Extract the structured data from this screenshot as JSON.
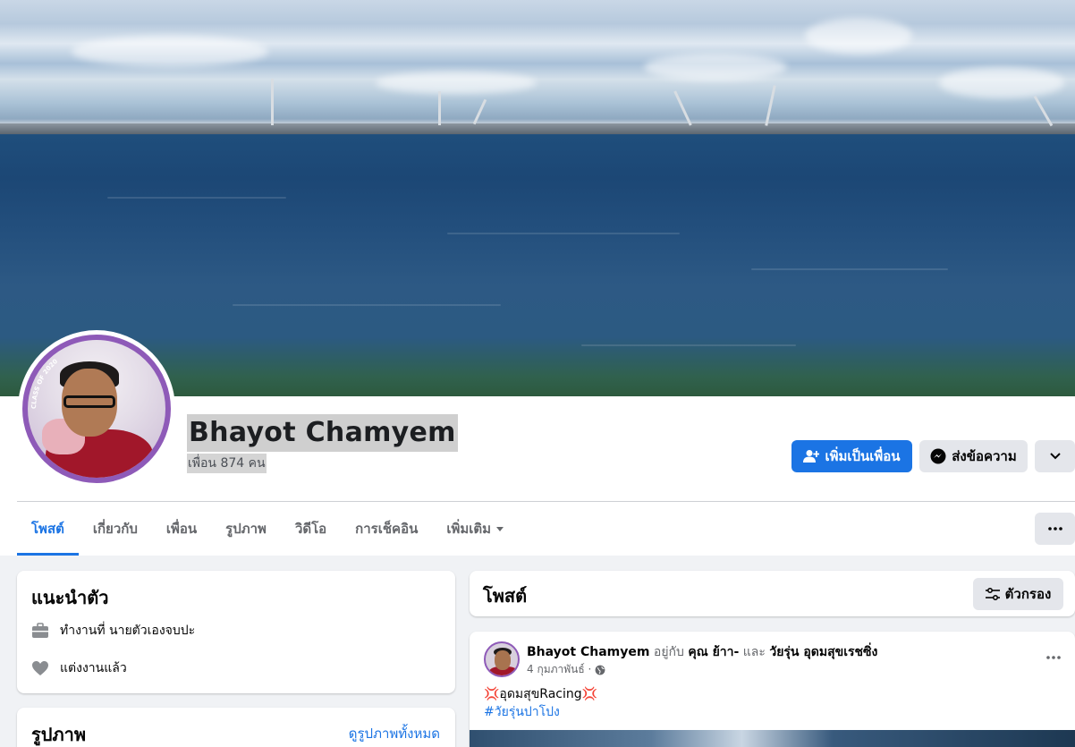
{
  "profile": {
    "name": "Bhayot Chamyem",
    "friends_count": "เพื่อน 874 คน",
    "avatar_ring_text": "CLASS OF 2020"
  },
  "actions": {
    "add_friend": "เพิ่มเป็นเพื่อน",
    "message": "ส่งข้อความ"
  },
  "tabs": [
    {
      "label": "โพสต์",
      "active": true
    },
    {
      "label": "เกี่ยวกับ",
      "active": false
    },
    {
      "label": "เพื่อน",
      "active": false
    },
    {
      "label": "รูปภาพ",
      "active": false
    },
    {
      "label": "วิดีโอ",
      "active": false
    },
    {
      "label": "การเช็คอิน",
      "active": false
    },
    {
      "label": "เพิ่มเติม",
      "active": false
    }
  ],
  "intro": {
    "title": "แนะนำตัว",
    "work": "ทำงานที่ นายตัวเองจบปะ",
    "relationship": "แต่งงานแล้ว"
  },
  "photos": {
    "title": "รูปภาพ",
    "see_all": "ดูรูปภาพทั้งหมด"
  },
  "posts_header": {
    "title": "โพสต์",
    "filter": "ตัวกรอง"
  },
  "post": {
    "author": "Bhayot Chamyem",
    "with_text": "อยู่กับ",
    "tagged_1": "คุณ ย้าา-",
    "and_text": "และ",
    "tagged_2": "วัยรุ่น อุดมสุขเรชซิ่ง",
    "date": "4 กุมภาพันธ์ ·",
    "body": "💢อุดมสุขRacing💢",
    "hashtag": "#วัยรุ่นปาโปง"
  },
  "colors": {
    "accent": "#1b74e4",
    "avatar_ring": "#8e5ab8"
  }
}
